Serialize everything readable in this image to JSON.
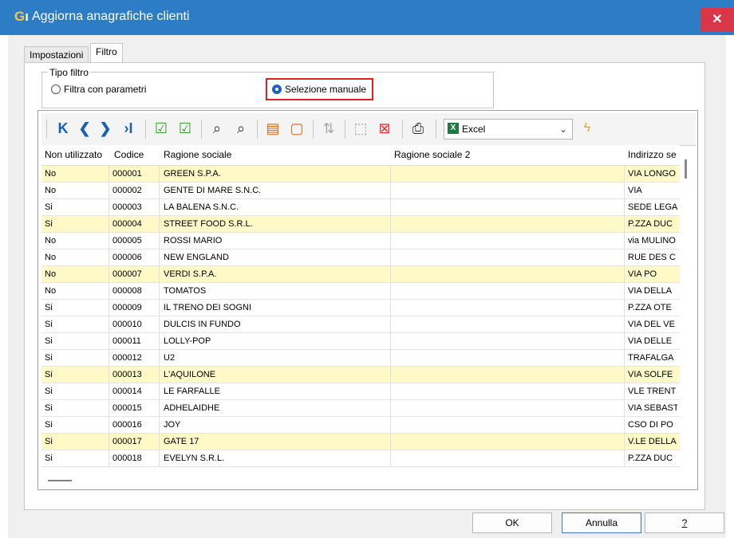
{
  "window": {
    "title": "Aggiorna anagrafiche clienti"
  },
  "tabs": [
    {
      "label": "Impostazioni"
    },
    {
      "label": "Filtro"
    }
  ],
  "filter": {
    "group_label": "Tipo filtro",
    "option_params": "Filtra con parametri",
    "option_manual": "Selezione manuale"
  },
  "toolbar": {
    "export_select": "Excel"
  },
  "grid": {
    "columns": [
      "Non utilizzato",
      "Codice",
      "Ragione sociale",
      "Ragione sociale 2",
      "Indirizzo se"
    ],
    "rows": [
      {
        "non_utilizzato": "No",
        "codice": "000001",
        "ragione": "GREEN S.P.A.",
        "ragione2": "",
        "indirizzo": "VIA LONGO",
        "highlight": true
      },
      {
        "non_utilizzato": "No",
        "codice": "000002",
        "ragione": "GENTE DI MARE S.N.C.",
        "ragione2": "",
        "indirizzo": "VIA",
        "highlight": false
      },
      {
        "non_utilizzato": "Si",
        "codice": "000003",
        "ragione": "LA BALENA S.N.C.",
        "ragione2": "",
        "indirizzo": "SEDE LEGA",
        "highlight": false
      },
      {
        "non_utilizzato": "Si",
        "codice": "000004",
        "ragione": "STREET FOOD S.R.L.",
        "ragione2": "",
        "indirizzo": "P.ZZA DUC",
        "highlight": true
      },
      {
        "non_utilizzato": "No",
        "codice": "000005",
        "ragione": "ROSSI MARIO",
        "ragione2": "",
        "indirizzo": "via MULINO",
        "highlight": false
      },
      {
        "non_utilizzato": "No",
        "codice": "000006",
        "ragione": "NEW ENGLAND",
        "ragione2": "",
        "indirizzo": "RUE DES C",
        "highlight": false
      },
      {
        "non_utilizzato": "No",
        "codice": "000007",
        "ragione": "VERDI S.P.A.",
        "ragione2": "",
        "indirizzo": "VIA PO",
        "highlight": true
      },
      {
        "non_utilizzato": "No",
        "codice": "000008",
        "ragione": "TOMATOS",
        "ragione2": "",
        "indirizzo": "VIA DELLA",
        "highlight": false
      },
      {
        "non_utilizzato": "Si",
        "codice": "000009",
        "ragione": "IL TRENO DEI SOGNI",
        "ragione2": "",
        "indirizzo": "P.ZZA OTE",
        "highlight": false
      },
      {
        "non_utilizzato": "Si",
        "codice": "000010",
        "ragione": "DULCIS IN FUNDO",
        "ragione2": "",
        "indirizzo": "VIA DEL VE",
        "highlight": false
      },
      {
        "non_utilizzato": "Si",
        "codice": "000011",
        "ragione": "LOLLY-POP",
        "ragione2": "",
        "indirizzo": "VIA DELLE",
        "highlight": false
      },
      {
        "non_utilizzato": "Si",
        "codice": "000012",
        "ragione": "U2",
        "ragione2": "",
        "indirizzo": "TRAFALGA",
        "highlight": false
      },
      {
        "non_utilizzato": "Si",
        "codice": "000013",
        "ragione": "L'AQUILONE",
        "ragione2": "",
        "indirizzo": "VIA SOLFE",
        "highlight": true
      },
      {
        "non_utilizzato": "Si",
        "codice": "000014",
        "ragione": "LE FARFALLE",
        "ragione2": "",
        "indirizzo": "VLE TRENT",
        "highlight": false
      },
      {
        "non_utilizzato": "Si",
        "codice": "000015",
        "ragione": "ADHELAIDHE",
        "ragione2": "",
        "indirizzo": "VIA SEBAST",
        "highlight": false
      },
      {
        "non_utilizzato": "Si",
        "codice": "000016",
        "ragione": "JOY",
        "ragione2": "",
        "indirizzo": "CSO DI PO",
        "highlight": false
      },
      {
        "non_utilizzato": "Si",
        "codice": "000017",
        "ragione": "GATE 17",
        "ragione2": "",
        "indirizzo": "V.LE DELLA",
        "highlight": true
      },
      {
        "non_utilizzato": "Si",
        "codice": "000018",
        "ragione": "EVELYN S.R.L.",
        "ragione2": "",
        "indirizzo": "P.ZZA DUC",
        "highlight": false
      }
    ]
  },
  "buttons": {
    "ok": "OK",
    "cancel": "Annulla",
    "help": "?"
  },
  "colors": {
    "titlebar": "#2c7cc6",
    "row_highlight": "#fff9c8",
    "radio_selected": "#1e62c8",
    "annotation_box": "#e02020"
  }
}
